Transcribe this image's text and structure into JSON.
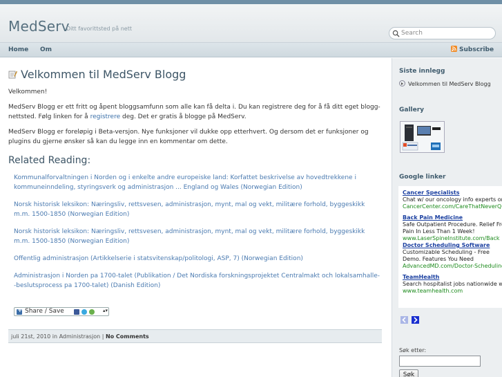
{
  "site": {
    "title": "MedServ",
    "tagline": "Ditt favorittsted på nett",
    "search_placeholder": "Search"
  },
  "nav": {
    "items": [
      {
        "label": "Home"
      },
      {
        "label": "Om"
      }
    ],
    "subscribe_label": "Subscribe"
  },
  "post": {
    "title": "Velkommen til MedServ Blogg",
    "greeting": "Velkommen!",
    "para1_before_link": "MedServ Blogg er ett fritt og åpent bloggsamfunn som alle kan få delta i. Du kan registrere deg for å få ditt eget blogg-nettsted. Følg linken for å ",
    "para1_link": "registrere",
    "para1_after_link": " deg. Det er gratis å blogge på MedServ.",
    "para2": "MedServ Blogg er foreløpig i Beta-versjon. Nye funksjoner vil dukke opp etterhvert. Og dersom det er funksjoner og plugins du gjerne ønsker så kan du legge inn en kommentar om dette.",
    "related_heading": "Related Reading:",
    "related": [
      {
        "text": "Kommunalforvaltningen i Norden og i enkelte andre europeiske land: Korfattet beskrivelse av hovedtrekkene i kommuneinndeling, styringsverk og administrasjon ... England og Wales (Norwegian Edition)"
      },
      {
        "text": "Norsk historisk leksikon: Næringsliv, rettsvesen, administrasjon, mynt, mal og vekt, militære forhold, byggeskikk m.m. 1500-1850 (Norwegian Edition)"
      },
      {
        "text": "Norsk historisk leksikon: Næringsliv, rettsvesen, administrasjon, mynt, mal og vekt, militære forhold, byggeskikk m.m. 1500-1850 (Norwegian Edition)"
      },
      {
        "text": "Offentlig administrasjon (Artikkelserie i statsvitenskap/politologi, ASP, 7) (Norwegian Edition)"
      },
      {
        "text": "Administrasjon i Norden pa 1700-talet (Publikation / Det Nordiska forskningsprojektet Centralmakt och lokalsamhalle--beslutsprocess pa 1700-talet) (Danish Edition)"
      }
    ],
    "share_label": "Share / Save",
    "meta_date": "juli 21st, 2010 in ",
    "meta_category": "Administrasjon",
    "meta_sep": " | ",
    "meta_comments": "No Comments"
  },
  "sidebar": {
    "recent_heading": "Siste innlegg",
    "recent_post": "Velkommen til MedServ Blogg",
    "gallery_heading": "Gallery",
    "google_heading": "Google linker",
    "ads": [
      {
        "title": "Cancer Specialists",
        "text": "Chat w/ our oncology info experts online",
        "url": "CancerCenter.com/CareThatNeverQuits"
      },
      {
        "title": "Back Pain Medicine",
        "text": "Safe Outpatient Procedure. Relief From Pain In Less Than 1 Week!",
        "url": "www.LaserSpineInstitute.com/Back"
      },
      {
        "title": "Doctor Scheduling Software",
        "text": "Customizable Scheduling - Free Demo. Features You Need",
        "url": "AdvancedMD.com/Doctor-Scheduling"
      },
      {
        "title": "TeamHealth",
        "text": "Search hospitalist jobs nationwide with TeamHealth",
        "url": "www.teamhealth.com"
      }
    ],
    "search_label": "Søk etter:",
    "search_value": "",
    "search_button": "Søk"
  },
  "colors": {
    "accent": "#3f5b6d",
    "link": "#4a7ab0",
    "ad_title": "#1a3fa0",
    "ad_url": "#1b8a1b"
  }
}
